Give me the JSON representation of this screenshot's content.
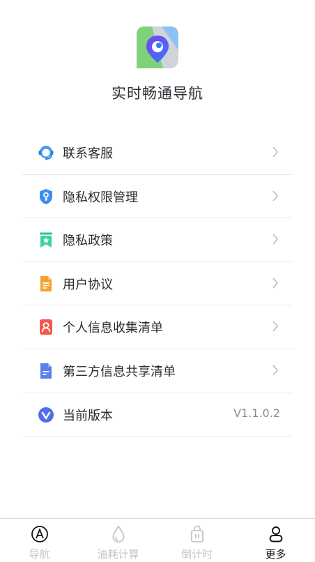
{
  "app": {
    "name": "实时畅通导航",
    "logo_icon": "map-pin-logo-icon"
  },
  "menu": {
    "items": [
      {
        "label": "联系客服",
        "icon": "customer-service-icon"
      },
      {
        "label": "隐私权限管理",
        "icon": "shield-key-icon"
      },
      {
        "label": "隐私政策",
        "icon": "bookmark-star-icon"
      },
      {
        "label": "用户协议",
        "icon": "document-icon"
      },
      {
        "label": "个人信息收集清单",
        "icon": "person-card-icon"
      },
      {
        "label": "第三方信息共享清单",
        "icon": "file-share-icon"
      },
      {
        "label": "当前版本",
        "icon": "version-v-icon",
        "value": "V1.1.0.2"
      }
    ]
  },
  "tabs": [
    {
      "label": "导航",
      "icon": "navigation-icon",
      "active": false
    },
    {
      "label": "油耗计算",
      "icon": "drop-icon",
      "active": false
    },
    {
      "label": "倒计时",
      "icon": "timer-icon",
      "active": false
    },
    {
      "label": "更多",
      "icon": "profile-icon",
      "active": true
    }
  ],
  "colors": {
    "tab_active": "#111111",
    "tab_inactive": "#c4c4c4",
    "divider": "#e8e8e8"
  }
}
